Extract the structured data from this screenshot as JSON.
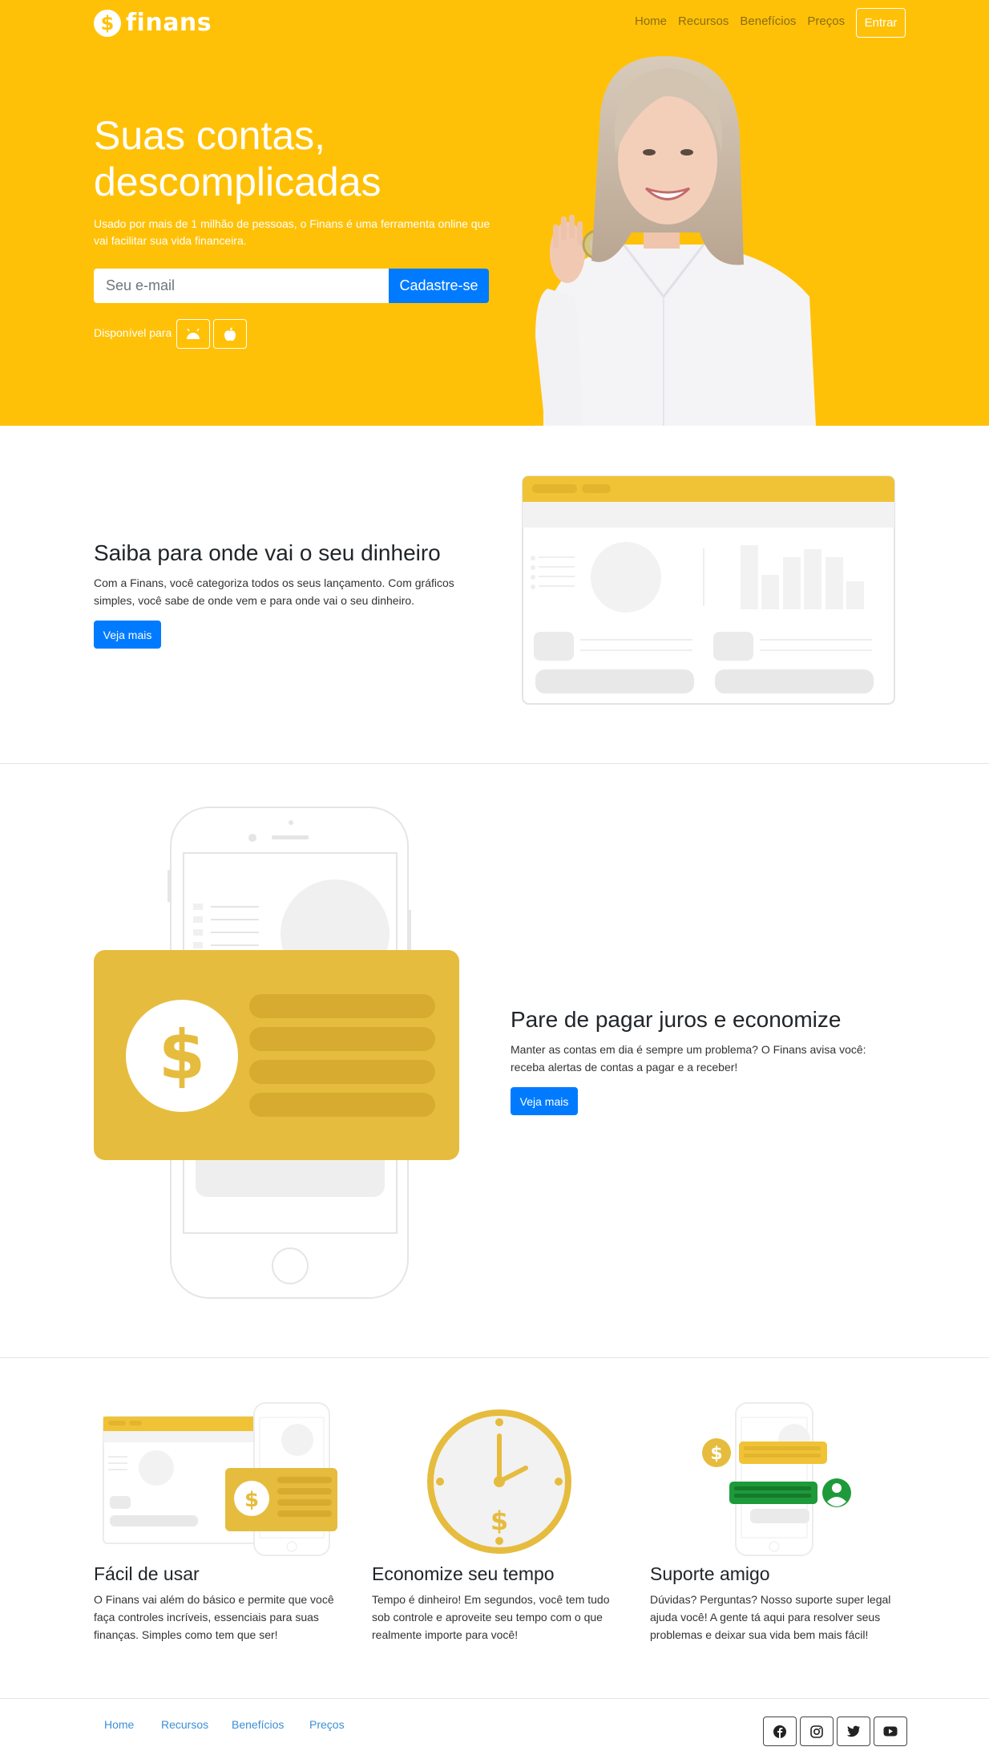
{
  "header": {
    "logo_text": "finans",
    "logo_symbol": "$",
    "nav": [
      "Home",
      "Recursos",
      "Benefícios",
      "Preços"
    ],
    "login_label": "Entrar"
  },
  "hero": {
    "title": "Suas contas, descomplicadas",
    "subtitle": "Usado por mais de 1 milhão de pessoas, o Finans é uma ferramenta online que vai facilitar sua vida financeira.",
    "email_placeholder": "Seu e-mail",
    "signup_label": "Cadastre-se",
    "available_label": "Disponível para",
    "stores": [
      "android-icon",
      "apple-icon"
    ]
  },
  "section1": {
    "title": "Saiba para onde vai o seu dinheiro",
    "text": "Com a Finans, você categoriza todos os seus lançamento. Com gráficos simples, você sabe de onde vem e para onde vai o seu dinheiro.",
    "button_label": "Veja mais"
  },
  "section2": {
    "title": "Pare de pagar juros e economize",
    "text": "Manter as contas em dia é sempre um problema? O Finans avisa você: receba alertas de contas a pagar e a receber!",
    "button_label": "Veja mais",
    "illustration_symbol": "$"
  },
  "features": [
    {
      "title": "Fácil de usar",
      "text": "O Finans vai além do básico e permite que você faça controles incríveis, essenciais para suas finanças. Simples como tem que ser!"
    },
    {
      "title": "Economize seu tempo",
      "text": "Tempo é dinheiro! Em segundos, você tem tudo sob controle e aproveite seu tempo com o que realmente importe para você!"
    },
    {
      "title": "Suporte amigo",
      "text": "Dúvidas? Perguntas? Nosso suporte super legal ajuda você! A gente tá aqui para resolver seus problemas e deixar sua vida bem mais fácil!"
    }
  ],
  "footer": {
    "links": [
      "Home",
      "Recursos",
      "Benefícios",
      "Preços"
    ],
    "social": [
      "facebook-icon",
      "instagram-icon",
      "twitter-icon",
      "youtube-icon"
    ]
  },
  "colors": {
    "brand": "#ffc107",
    "primary": "#007bff",
    "illustration_gold": "#e6bc3e"
  }
}
